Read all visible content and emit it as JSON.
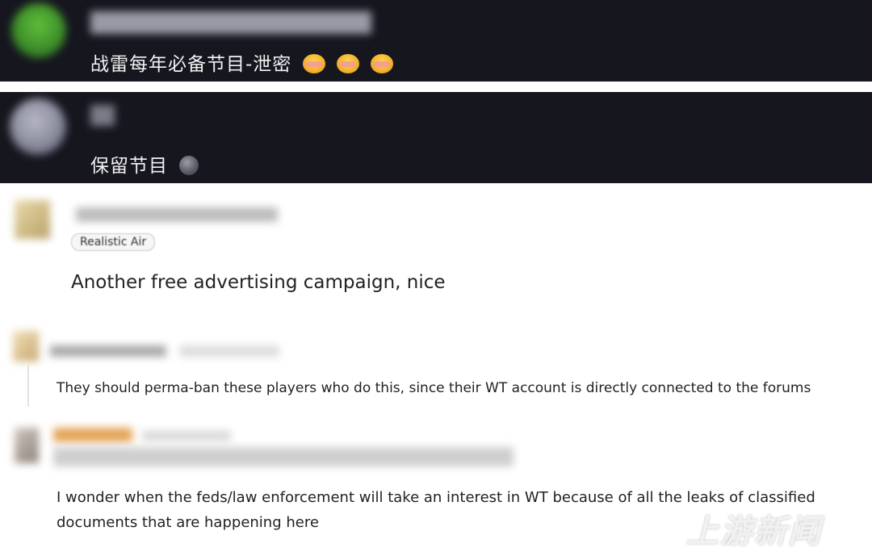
{
  "comments_dark": [
    {
      "text": "战雷每年必备节目-泄密",
      "emojis": [
        "smiling-face-hearts-icon",
        "smiling-face-hearts-icon",
        "smiling-face-hearts-icon"
      ]
    },
    {
      "text": "保留节目",
      "emojis": [
        "new-moon-icon"
      ]
    }
  ],
  "forum_comments": [
    {
      "badge": "Realistic Air",
      "text": "Another free advertising campaign, nice"
    },
    {
      "text": "They should perma-ban these players who do this, since their WT account is directly connected to the forums"
    },
    {
      "text_line1": "I wonder when the feds/law enforcement will take an interest in WT because of all the leaks of classified",
      "text_line2": "documents that are happening here"
    }
  ],
  "watermark": {
    "text": "上游新闻"
  },
  "colors": {
    "dark_bg": "#16161f",
    "light_bg": "#ffffff"
  }
}
